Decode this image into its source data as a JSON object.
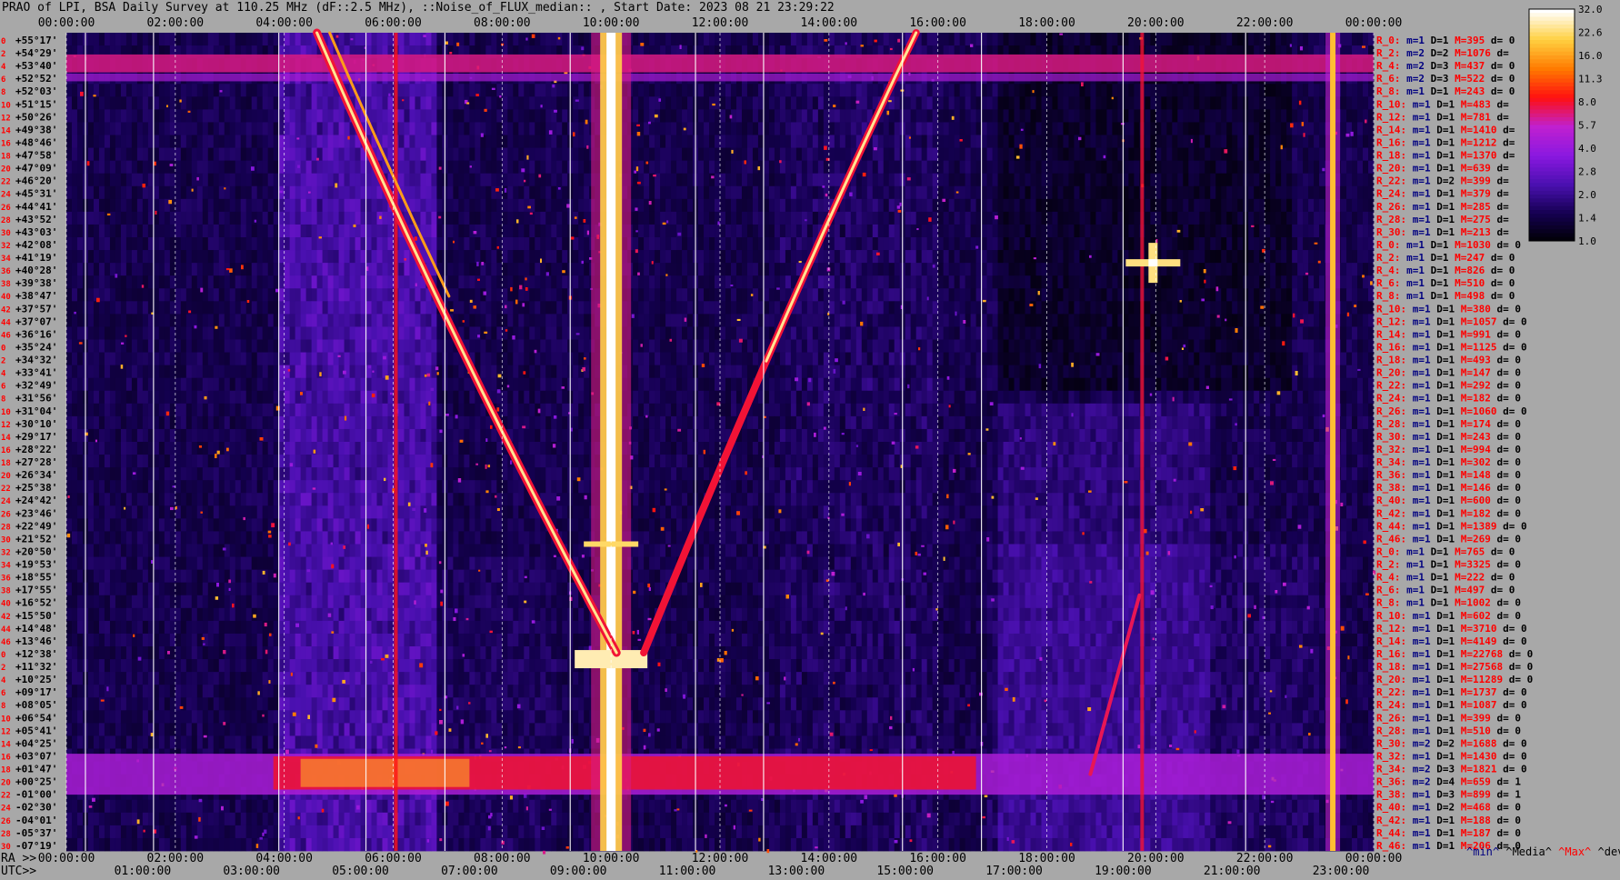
{
  "title": "PRAO of LPI, BSA Daily Survey at 110.25 MHz (dF::2.5 MHz), ::Noise_of_FLUX_median:: , Start Date: 2023 08 21 23:29:22",
  "footer": {
    "ra_prefix": "RA >>",
    "utc_prefix": "UTC>>",
    "legend": [
      "^min^",
      "^Media^",
      "^Max^",
      "^devia^"
    ]
  },
  "colors": {
    "background": "#a8a8a8",
    "row_label": "#ff0000",
    "m_label": "#000080",
    "max_label": "#ff0000",
    "colormap": [
      "#000000",
      "#140050",
      "#4a10b0",
      "#8a18e0",
      "#c020d0",
      "#ff1010",
      "#ff7a00",
      "#ffd040",
      "#ffffff"
    ]
  },
  "chart_data": {
    "type": "heatmap",
    "xlabel": "RA",
    "x2label": "UTC",
    "ra_ticks": [
      "00:00:00",
      "02:00:00",
      "04:00:00",
      "06:00:00",
      "08:00:00",
      "10:00:00",
      "12:00:00",
      "14:00:00",
      "16:00:00",
      "18:00:00",
      "20:00:00",
      "22:00:00",
      "00:00:00"
    ],
    "ra_ticks_bottom": [
      "00:00:00",
      "02:00:00",
      "04:00:00",
      "06:00:00",
      "08:00:00",
      "10:00:00",
      "12:00:00",
      "14:00:00",
      "16:00:00",
      "18:00:00",
      "20:00:00",
      "22:00:00",
      "00:00:00"
    ],
    "utc_ticks": [
      "01:00:00",
      "03:00:00",
      "05:00:00",
      "07:00:00",
      "09:00:00",
      "11:00:00",
      "13:00:00",
      "15:00:00",
      "17:00:00",
      "19:00:00",
      "21:00:00",
      "23:00:00"
    ],
    "colorbar": {
      "ticks": [
        "32.0",
        "22.6",
        "16.0",
        "11.3",
        "8.0",
        "5.7",
        "4.0",
        "2.8",
        "2.0",
        "1.4",
        "1.0"
      ],
      "min": 1.0,
      "max": 32.0
    },
    "dec_labels": [
      "+55°17'",
      "+54°29'",
      "+53°40'",
      "+52°52'",
      "+52°03'",
      "+51°15'",
      "+50°26'",
      "+49°38'",
      "+48°46'",
      "+47°58'",
      "+47°09'",
      "+46°20'",
      "+45°31'",
      "+44°41'",
      "+43°52'",
      "+43°03'",
      "+42°08'",
      "+41°19'",
      "+40°28'",
      "+39°38'",
      "+38°47'",
      "+37°57'",
      "+37°07'",
      "+36°16'",
      "+35°24'",
      "+34°32'",
      "+33°41'",
      "+32°49'",
      "+31°56'",
      "+31°04'",
      "+30°10'",
      "+29°17'",
      "+28°22'",
      "+27°28'",
      "+26°34'",
      "+25°38'",
      "+24°42'",
      "+23°46'",
      "+22°49'",
      "+21°52'",
      "+20°50'",
      "+19°53'",
      "+18°55'",
      "+17°55'",
      "+16°52'",
      "+15°50'",
      "+14°48'",
      "+13°46'",
      "+12°38'",
      "+11°32'",
      "+10°25'",
      "+09°17'",
      "+08°05'",
      "+06°54'",
      "+05°41'",
      "+04°25'",
      "+03°07'",
      "+01°47'",
      "+00°25'",
      "-01°00'",
      "-02°30'",
      "-04°01'",
      "-05°37'",
      "-07°19'"
    ],
    "row_stats": [
      {
        "r": "R_0:",
        "m": "m=1",
        "d": "D=1",
        "M": "M=395",
        "dv": "d= 0"
      },
      {
        "r": "R_2:",
        "m": "m=2",
        "d": "D=2",
        "M": "M=1076",
        "dv": "d="
      },
      {
        "r": "R_4:",
        "m": "m=2",
        "d": "D=3",
        "M": "M=437",
        "dv": "d= 0"
      },
      {
        "r": "R_6:",
        "m": "m=2",
        "d": "D=3",
        "M": "M=522",
        "dv": "d= 0"
      },
      {
        "r": "R_8:",
        "m": "m=1",
        "d": "D=1",
        "M": "M=243",
        "dv": "d= 0"
      },
      {
        "r": "R_10:",
        "m": "m=1",
        "d": "D=1",
        "M": "M=483",
        "dv": "d="
      },
      {
        "r": "R_12:",
        "m": "m=1",
        "d": "D=1",
        "M": "M=781",
        "dv": "d="
      },
      {
        "r": "R_14:",
        "m": "m=1",
        "d": "D=1",
        "M": "M=1410",
        "dv": "d="
      },
      {
        "r": "R_16:",
        "m": "m=1",
        "d": "D=1",
        "M": "M=1212",
        "dv": "d="
      },
      {
        "r": "R_18:",
        "m": "m=1",
        "d": "D=1",
        "M": "M=1370",
        "dv": "d="
      },
      {
        "r": "R_20:",
        "m": "m=1",
        "d": "D=1",
        "M": "M=639",
        "dv": "d="
      },
      {
        "r": "R_22:",
        "m": "m=1",
        "d": "D=2",
        "M": "M=399",
        "dv": "d="
      },
      {
        "r": "R_24:",
        "m": "m=1",
        "d": "D=1",
        "M": "M=379",
        "dv": "d="
      },
      {
        "r": "R_26:",
        "m": "m=1",
        "d": "D=1",
        "M": "M=285",
        "dv": "d="
      },
      {
        "r": "R_28:",
        "m": "m=1",
        "d": "D=1",
        "M": "M=275",
        "dv": "d="
      },
      {
        "r": "R_30:",
        "m": "m=1",
        "d": "D=1",
        "M": "M=213",
        "dv": "d="
      },
      {
        "r": "R_0:",
        "m": "m=1",
        "d": "D=1",
        "M": "M=1030",
        "dv": "d= 0"
      },
      {
        "r": "R_2:",
        "m": "m=1",
        "d": "D=1",
        "M": "M=247",
        "dv": "d= 0"
      },
      {
        "r": "R_4:",
        "m": "m=1",
        "d": "D=1",
        "M": "M=826",
        "dv": "d= 0"
      },
      {
        "r": "R_6:",
        "m": "m=1",
        "d": "D=1",
        "M": "M=510",
        "dv": "d= 0"
      },
      {
        "r": "R_8:",
        "m": "m=1",
        "d": "D=1",
        "M": "M=498",
        "dv": "d= 0"
      },
      {
        "r": "R_10:",
        "m": "m=1",
        "d": "D=1",
        "M": "M=380",
        "dv": "d= 0"
      },
      {
        "r": "R_12:",
        "m": "m=1",
        "d": "D=1",
        "M": "M=1057",
        "dv": "d= 0"
      },
      {
        "r": "R_14:",
        "m": "m=1",
        "d": "D=1",
        "M": "M=991",
        "dv": "d= 0"
      },
      {
        "r": "R_16:",
        "m": "m=1",
        "d": "D=1",
        "M": "M=1125",
        "dv": "d= 0"
      },
      {
        "r": "R_18:",
        "m": "m=1",
        "d": "D=1",
        "M": "M=493",
        "dv": "d= 0"
      },
      {
        "r": "R_20:",
        "m": "m=1",
        "d": "D=1",
        "M": "M=147",
        "dv": "d= 0"
      },
      {
        "r": "R_22:",
        "m": "m=1",
        "d": "D=1",
        "M": "M=292",
        "dv": "d= 0"
      },
      {
        "r": "R_24:",
        "m": "m=1",
        "d": "D=1",
        "M": "M=182",
        "dv": "d= 0"
      },
      {
        "r": "R_26:",
        "m": "m=1",
        "d": "D=1",
        "M": "M=1060",
        "dv": "d= 0"
      },
      {
        "r": "R_28:",
        "m": "m=1",
        "d": "D=1",
        "M": "M=174",
        "dv": "d= 0"
      },
      {
        "r": "R_30:",
        "m": "m=1",
        "d": "D=1",
        "M": "M=243",
        "dv": "d= 0"
      },
      {
        "r": "R_32:",
        "m": "m=1",
        "d": "D=1",
        "M": "M=994",
        "dv": "d= 0"
      },
      {
        "r": "R_34:",
        "m": "m=1",
        "d": "D=1",
        "M": "M=302",
        "dv": "d= 0"
      },
      {
        "r": "R_36:",
        "m": "m=1",
        "d": "D=1",
        "M": "M=148",
        "dv": "d= 0"
      },
      {
        "r": "R_38:",
        "m": "m=1",
        "d": "D=1",
        "M": "M=146",
        "dv": "d= 0"
      },
      {
        "r": "R_40:",
        "m": "m=1",
        "d": "D=1",
        "M": "M=600",
        "dv": "d= 0"
      },
      {
        "r": "R_42:",
        "m": "m=1",
        "d": "D=1",
        "M": "M=182",
        "dv": "d= 0"
      },
      {
        "r": "R_44:",
        "m": "m=1",
        "d": "D=1",
        "M": "M=1389",
        "dv": "d= 0"
      },
      {
        "r": "R_46:",
        "m": "m=1",
        "d": "D=1",
        "M": "M=269",
        "dv": "d= 0"
      },
      {
        "r": "R_0:",
        "m": "m=1",
        "d": "D=1",
        "M": "M=765",
        "dv": "d= 0"
      },
      {
        "r": "R_2:",
        "m": "m=1",
        "d": "D=1",
        "M": "M=3325",
        "dv": "d= 0"
      },
      {
        "r": "R_4:",
        "m": "m=1",
        "d": "D=1",
        "M": "M=222",
        "dv": "d= 0"
      },
      {
        "r": "R_6:",
        "m": "m=1",
        "d": "D=1",
        "M": "M=497",
        "dv": "d= 0"
      },
      {
        "r": "R_8:",
        "m": "m=1",
        "d": "D=1",
        "M": "M=1002",
        "dv": "d= 0"
      },
      {
        "r": "R_10:",
        "m": "m=1",
        "d": "D=1",
        "M": "M=602",
        "dv": "d= 0"
      },
      {
        "r": "R_12:",
        "m": "m=1",
        "d": "D=1",
        "M": "M=3710",
        "dv": "d= 0"
      },
      {
        "r": "R_14:",
        "m": "m=1",
        "d": "D=1",
        "M": "M=4149",
        "dv": "d= 0"
      },
      {
        "r": "R_16:",
        "m": "m=1",
        "d": "D=1",
        "M": "M=22768",
        "dv": "d= 0"
      },
      {
        "r": "R_18:",
        "m": "m=1",
        "d": "D=1",
        "M": "M=27568",
        "dv": "d= 0"
      },
      {
        "r": "R_20:",
        "m": "m=1",
        "d": "D=1",
        "M": "M=11289",
        "dv": "d= 0"
      },
      {
        "r": "R_22:",
        "m": "m=1",
        "d": "D=1",
        "M": "M=1737",
        "dv": "d= 0"
      },
      {
        "r": "R_24:",
        "m": "m=1",
        "d": "D=1",
        "M": "M=1087",
        "dv": "d= 0"
      },
      {
        "r": "R_26:",
        "m": "m=1",
        "d": "D=1",
        "M": "M=399",
        "dv": "d= 0"
      },
      {
        "r": "R_28:",
        "m": "m=1",
        "d": "D=1",
        "M": "M=510",
        "dv": "d= 0"
      },
      {
        "r": "R_30:",
        "m": "m=2",
        "d": "D=2",
        "M": "M=1688",
        "dv": "d= 0"
      },
      {
        "r": "R_32:",
        "m": "m=1",
        "d": "D=1",
        "M": "M=1430",
        "dv": "d= 0"
      },
      {
        "r": "R_34:",
        "m": "m=2",
        "d": "D=3",
        "M": "M=1821",
        "dv": "d= 0"
      },
      {
        "r": "R_36:",
        "m": "m=2",
        "d": "D=4",
        "M": "M=659",
        "dv": "d= 1"
      },
      {
        "r": "R_38:",
        "m": "m=1",
        "d": "D=3",
        "M": "M=899",
        "dv": "d= 1"
      },
      {
        "r": "R_40:",
        "m": "m=1",
        "d": "D=2",
        "M": "M=468",
        "dv": "d= 0"
      },
      {
        "r": "R_42:",
        "m": "m=1",
        "d": "D=1",
        "M": "M=188",
        "dv": "d= 0"
      },
      {
        "r": "R_44:",
        "m": "m=1",
        "d": "D=1",
        "M": "M=187",
        "dv": "d= 0"
      },
      {
        "r": "R_46:",
        "m": "m=1",
        "d": "D=1",
        "M": "M=206",
        "dv": "d= 0"
      }
    ],
    "features": [
      {
        "name": "Cas A / strong source track (descending)",
        "type": "curve",
        "ra_start": "04:35",
        "ra_end": "08:40",
        "note": "drift curve"
      },
      {
        "name": "Cyg A (vertical saturated column)",
        "type": "vertical",
        "ra": "10:00"
      },
      {
        "name": "ascending track",
        "type": "curve",
        "ra_start": "11:30",
        "ra_end": "15:45"
      },
      {
        "name": "bright point source",
        "type": "point",
        "ra": "19:58",
        "dec": "+40°28'"
      },
      {
        "name": "vertical interference column",
        "type": "vertical",
        "ra": "23:15"
      },
      {
        "name": "horizontal interference band",
        "type": "band",
        "dec": "+00°25'"
      },
      {
        "name": "horizontal interference band",
        "type": "band",
        "dec": "+53°40'"
      }
    ]
  }
}
